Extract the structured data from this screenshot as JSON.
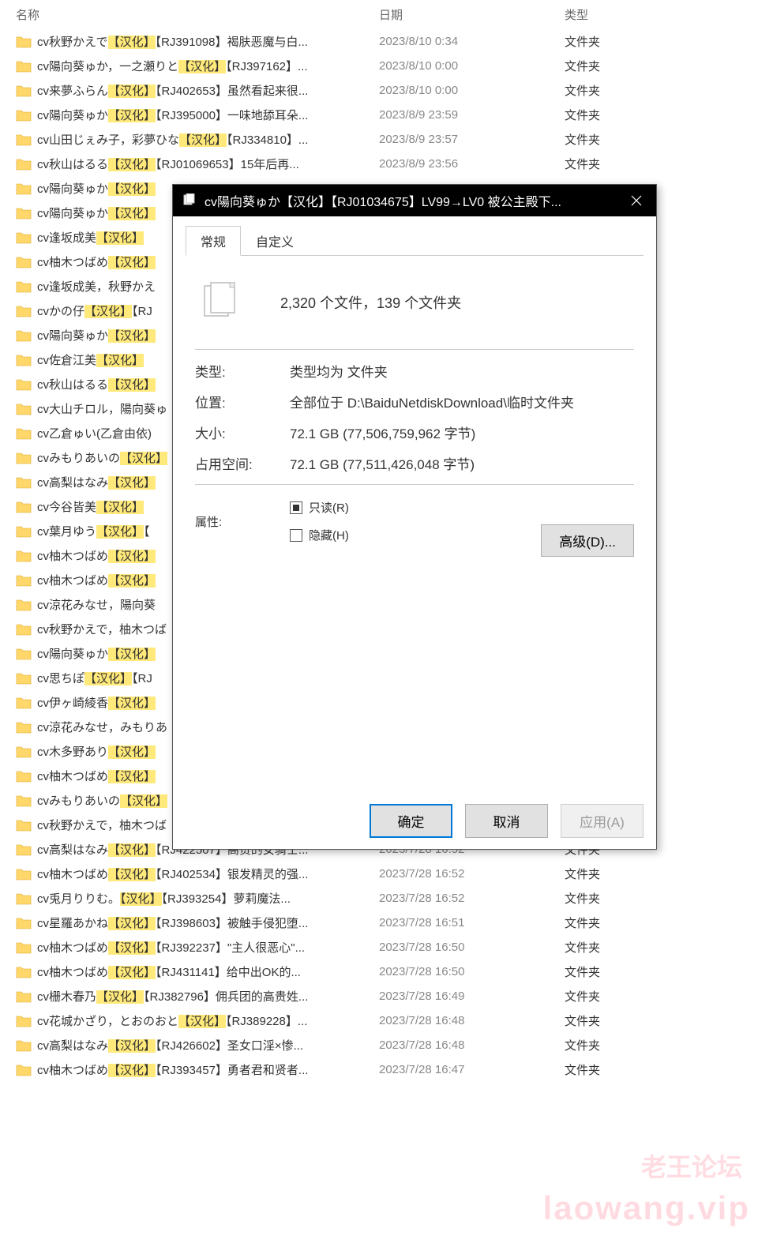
{
  "headers": {
    "name": "名称",
    "date": "日期",
    "type": "类型"
  },
  "folder_type": "文件夹",
  "rows": [
    {
      "parts": [
        "cv秋野かえで",
        [
          "【汉化】"
        ],
        "【RJ391098】褐肤恶魔与白..."
      ],
      "date": "2023/8/10 0:34"
    },
    {
      "parts": [
        "cv陽向葵ゅか，一之瀬りと",
        [
          "【汉化】"
        ],
        "【RJ397162】..."
      ],
      "date": "2023/8/10 0:00"
    },
    {
      "parts": [
        "cv来夢ふらん",
        [
          "【汉化】"
        ],
        "【RJ402653】虽然看起来很..."
      ],
      "date": "2023/8/10 0:00"
    },
    {
      "parts": [
        "cv陽向葵ゅか",
        [
          "【汉化】"
        ],
        "【RJ395000】一味地舔耳朵..."
      ],
      "date": "2023/8/9 23:59"
    },
    {
      "parts": [
        "cv山田じぇみ子，彩夢ひな",
        [
          "【汉化】"
        ],
        "【RJ334810】..."
      ],
      "date": "2023/8/9 23:57"
    },
    {
      "parts": [
        "cv秋山はるる",
        [
          "【汉化】"
        ],
        "【RJ01069653】15年后再..."
      ],
      "date": "2023/8/9 23:56"
    },
    {
      "parts": [
        "cv陽向葵ゅか",
        [
          "【汉化】"
        ]
      ],
      "date": ""
    },
    {
      "parts": [
        "cv陽向葵ゅか",
        [
          "【汉化】"
        ]
      ],
      "date": ""
    },
    {
      "parts": [
        "cv逢坂成美",
        [
          "【汉化】"
        ]
      ],
      "date": ""
    },
    {
      "parts": [
        "cv柚木つばめ",
        [
          "【汉化】"
        ]
      ],
      "date": ""
    },
    {
      "parts": [
        "cv逢坂成美，秋野かえ"
      ],
      "date": ""
    },
    {
      "parts": [
        "cvかの仔",
        [
          "【汉化】"
        ],
        "【RJ"
      ],
      "date": ""
    },
    {
      "parts": [
        "cv陽向葵ゅか",
        [
          "【汉化】"
        ]
      ],
      "date": ""
    },
    {
      "parts": [
        "cv佐倉江美",
        [
          "【汉化】"
        ]
      ],
      "date": ""
    },
    {
      "parts": [
        "cv秋山はるる",
        [
          "【汉化】"
        ]
      ],
      "date": ""
    },
    {
      "parts": [
        "cv大山チロル，陽向葵ゅ"
      ],
      "date": ""
    },
    {
      "parts": [
        "cv乙倉ゅい(乙倉由依)"
      ],
      "date": ""
    },
    {
      "parts": [
        "cvみもりあいの",
        [
          "【汉化】"
        ]
      ],
      "date": ""
    },
    {
      "parts": [
        "cv高梨はなみ",
        [
          "【汉化】"
        ]
      ],
      "date": ""
    },
    {
      "parts": [
        "cv今谷皆美",
        [
          "【汉化】"
        ]
      ],
      "date": ""
    },
    {
      "parts": [
        "cv葉月ゆう",
        [
          "【汉化】"
        ],
        "【"
      ],
      "date": ""
    },
    {
      "parts": [
        "cv柚木つばめ",
        [
          "【汉化】"
        ]
      ],
      "date": ""
    },
    {
      "parts": [
        "cv柚木つばめ",
        [
          "【汉化】"
        ]
      ],
      "date": ""
    },
    {
      "parts": [
        "cv涼花みなせ，陽向葵"
      ],
      "date": ""
    },
    {
      "parts": [
        "cv秋野かえで，柚木つば"
      ],
      "date": ""
    },
    {
      "parts": [
        "cv陽向葵ゅか",
        [
          "【汉化】"
        ]
      ],
      "date": ""
    },
    {
      "parts": [
        "cv思ちぽ",
        [
          "【汉化】"
        ],
        "【RJ"
      ],
      "date": ""
    },
    {
      "parts": [
        "cv伊ヶ崎綾香",
        [
          "【汉化】"
        ]
      ],
      "date": ""
    },
    {
      "parts": [
        "cv涼花みなせ，みもりあ"
      ],
      "date": ""
    },
    {
      "parts": [
        "cv木多野あり",
        [
          "【汉化】"
        ]
      ],
      "date": ""
    },
    {
      "parts": [
        "cv柚木つばめ",
        [
          "【汉化】"
        ]
      ],
      "date": ""
    },
    {
      "parts": [
        "cvみもりあいの",
        [
          "【汉化】"
        ]
      ],
      "date": ""
    },
    {
      "parts": [
        "cv秋野かえで，柚木つば"
      ],
      "date": ""
    },
    {
      "parts": [
        "cv高梨はなみ",
        [
          "【汉化】"
        ],
        "【RJ422507】高贵的女骑士..."
      ],
      "date": "2023/7/28 16:52"
    },
    {
      "parts": [
        "cv柚木つばめ",
        [
          "【汉化】"
        ],
        "【RJ402534】银发精灵的强..."
      ],
      "date": "2023/7/28 16:52"
    },
    {
      "parts": [
        "cv兎月りりむ。",
        [
          "【汉化】"
        ],
        "【RJ393254】萝莉魔法..."
      ],
      "date": "2023/7/28 16:52"
    },
    {
      "parts": [
        "cv星羅あかね",
        [
          "【汉化】"
        ],
        "【RJ398603】被触手侵犯堕..."
      ],
      "date": "2023/7/28 16:51"
    },
    {
      "parts": [
        "cv柚木つばめ",
        [
          "【汉化】"
        ],
        "【RJ392237】\"主人很恶心\"..."
      ],
      "date": "2023/7/28 16:50"
    },
    {
      "parts": [
        "cv柚木つばめ",
        [
          "【汉化】"
        ],
        "【RJ431141】给中出OK的..."
      ],
      "date": "2023/7/28 16:50"
    },
    {
      "parts": [
        "cv栅木春乃",
        [
          "【汉化】"
        ],
        "【RJ382796】佣兵团的高贵姓..."
      ],
      "date": "2023/7/28 16:49"
    },
    {
      "parts": [
        "cv花城かざり，とおのおと",
        [
          "【汉化】"
        ],
        "【RJ389228】..."
      ],
      "date": "2023/7/28 16:48"
    },
    {
      "parts": [
        "cv高梨はなみ",
        [
          "【汉化】"
        ],
        "【RJ426602】圣女口淫×惨..."
      ],
      "date": "2023/7/28 16:48"
    },
    {
      "parts": [
        "cv柚木つばめ",
        [
          "【汉化】"
        ],
        "【RJ393457】勇者君和贤者..."
      ],
      "date": "2023/7/28 16:47"
    }
  ],
  "dialog": {
    "title": "cv陽向葵ゅか【汉化】【RJ01034675】LV99→LV0 被公主殿下...",
    "tabs": {
      "general": "常规",
      "custom": "自定义"
    },
    "summary": "2,320 个文件，139 个文件夹",
    "labels": {
      "type": "类型:",
      "location": "位置:",
      "size": "大小:",
      "sizeOnDisk": "占用空间:",
      "attrs": "属性:"
    },
    "values": {
      "type": "类型均为 文件夹",
      "location": "全部位于 D:\\BaiduNetdiskDownload\\临时文件夹",
      "size": "72.1 GB (77,506,759,962 字节)",
      "sizeOnDisk": "72.1 GB (77,511,426,048 字节)"
    },
    "readonly_label": "只读(R)",
    "hidden_label": "隐藏(H)",
    "advanced": "高级(D)...",
    "ok": "确定",
    "cancel": "取消",
    "apply": "应用(A)"
  },
  "watermark": {
    "line1": "老王论坛",
    "line2": "laowang.vip"
  }
}
